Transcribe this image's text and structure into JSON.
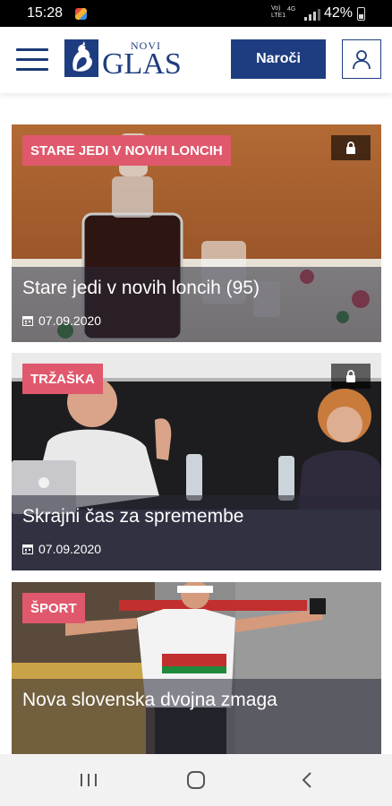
{
  "status_bar": {
    "time": "15:28",
    "network": "Vo) LTE1",
    "signal": "4G",
    "battery": "42%"
  },
  "header": {
    "logo_top": "NOVI",
    "logo_main": "GLAS",
    "subscribe_label": "Naroči",
    "menu_icon": "hamburger-icon",
    "user_icon": "user-icon",
    "accent_color": "#1e3d80"
  },
  "articles": [
    {
      "tag": "STARE JEDI V NOVIH LONCIH",
      "locked": true,
      "title": "Stare jedi v novih loncih (95)",
      "date": "07.09.2020"
    },
    {
      "tag": "TRŽAŠKA",
      "locked": true,
      "title": "Skrajni čas za spremembe",
      "date": "07.09.2020"
    },
    {
      "tag": "ŠPORT",
      "locked": false,
      "title": "Nova slovenska dvojna zmaga",
      "date": ""
    }
  ],
  "tag_color": "#e0586c"
}
